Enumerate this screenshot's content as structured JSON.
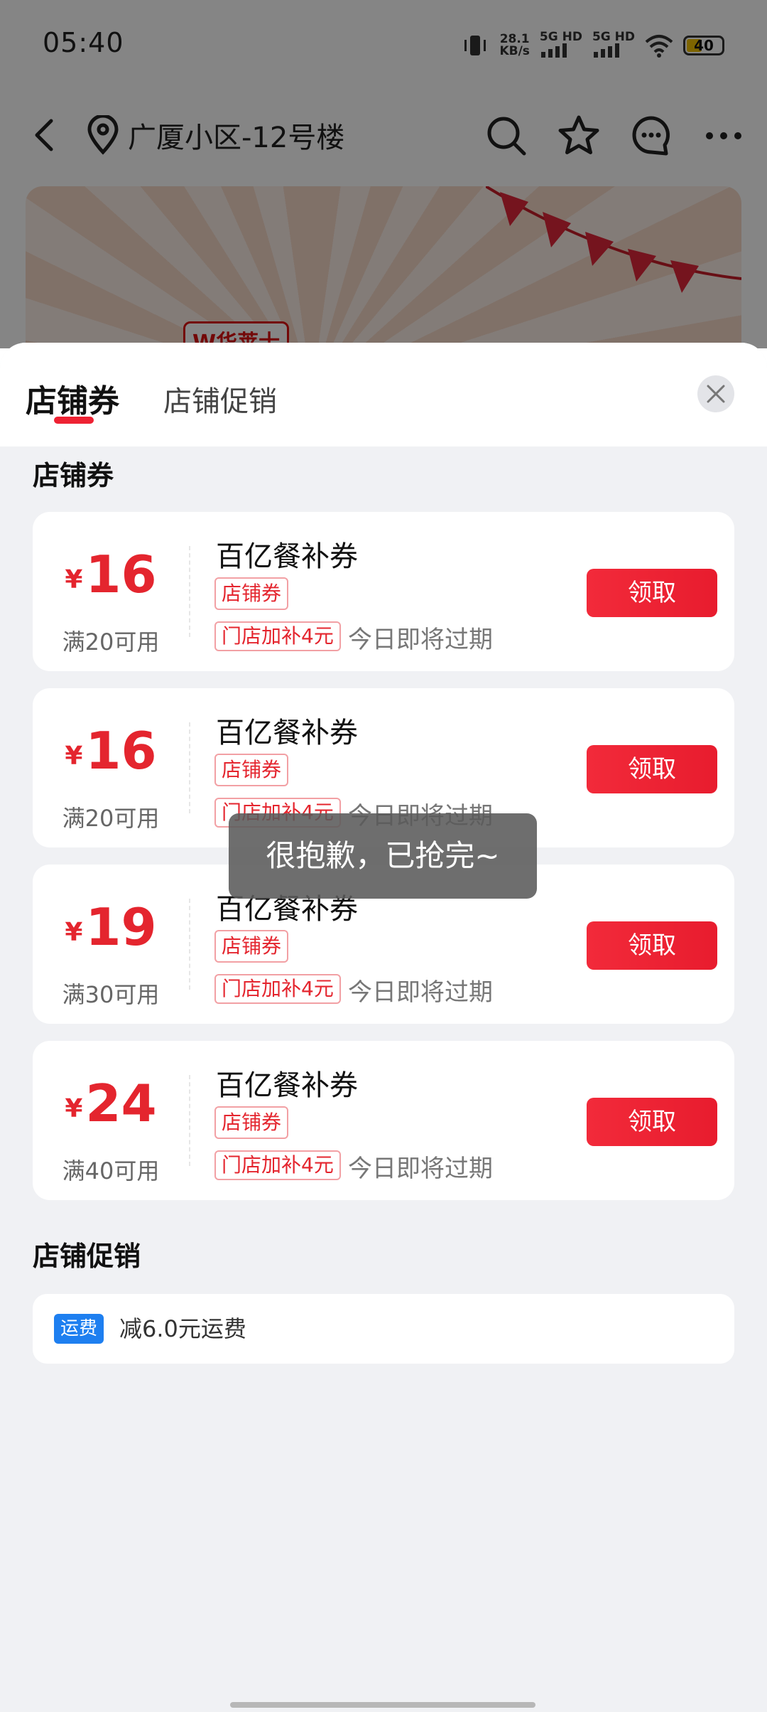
{
  "status_bar": {
    "time": "05:40",
    "net_speed_value": "28.1",
    "net_speed_unit": "KB/s",
    "sim1": "5G HD",
    "sim2": "5G HD",
    "battery": "40"
  },
  "header": {
    "location": "广厦小区-12号楼"
  },
  "banner": {
    "logo_text": "W华莱士"
  },
  "sheet": {
    "tabs": [
      {
        "label": "店铺券",
        "active": true
      },
      {
        "label": "店铺促销",
        "active": false
      }
    ],
    "coupon_section_title": "店铺券",
    "promo_section_title": "店铺促销"
  },
  "coupons": [
    {
      "currency": "¥",
      "amount": "16",
      "condition": "满20可用",
      "name": "百亿餐补券",
      "tag": "店铺券",
      "sub_tag": "门店加补4元",
      "expire": "今日即将过期",
      "button": "领取"
    },
    {
      "currency": "¥",
      "amount": "16",
      "condition": "满20可用",
      "name": "百亿餐补券",
      "tag": "店铺券",
      "sub_tag": "门店加补4元",
      "expire": "今日即将过期",
      "button": "领取"
    },
    {
      "currency": "¥",
      "amount": "19",
      "condition": "满30可用",
      "name": "百亿餐补券",
      "tag": "店铺券",
      "sub_tag": "门店加补4元",
      "expire": "今日即将过期",
      "button": "领取"
    },
    {
      "currency": "¥",
      "amount": "24",
      "condition": "满40可用",
      "name": "百亿餐补券",
      "tag": "店铺券",
      "sub_tag": "门店加补4元",
      "expire": "今日即将过期",
      "button": "领取"
    }
  ],
  "promotion": {
    "tag": "运费",
    "text": "减6.0元运费"
  },
  "toast": "很抱歉，已抢完~",
  "colors": {
    "accent_red": "#e4252e",
    "button_red": "#f22a3a",
    "promo_blue": "#1e7ff0",
    "sheet_bg": "#f0f1f4"
  }
}
